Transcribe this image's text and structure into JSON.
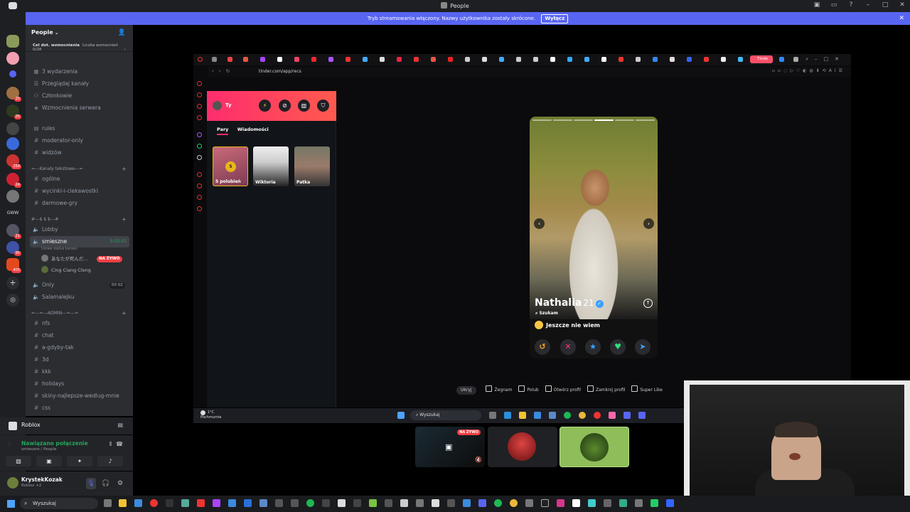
{
  "window": {
    "title": "People"
  },
  "banner": {
    "text": "Tryb streamowania włączony. Nazwy użytkownika zostały skrócone.",
    "button": "Wyłącz"
  },
  "server": {
    "name": "People",
    "boost_goal_label": "Cel dot. wzmocnienia",
    "boost_count": "Liczba wzmocnień 0/28"
  },
  "channels": {
    "events": "3 wydarzenia",
    "browse": "Przeglądaj kanały",
    "members": "Członkowie",
    "boosts": "Wzmocnienia serwera",
    "rules": "rules",
    "moderator_only": "moderator-only",
    "widzow": "widzów",
    "cat_text": "=---Kanały tekstowe---=",
    "ogolne": "ogólne",
    "wycinki": "wycinki-i-ciekawostki",
    "darmowe": "darmowe-gry",
    "cat_voice": "#---$ $ $---#",
    "lobby": "Lobby",
    "smieszne": "smieszne",
    "smieszne_timer": "5:03:01",
    "smieszne_sub": "Ustaw status kanału",
    "voice_user_1": "あなたが死んだ...",
    "live_badge": "NA ŻYWO",
    "voice_user_2": "Cing Ciang Clong",
    "only": "Only",
    "only_count": "00 02",
    "salamalejku": "Salamalejku",
    "cat_admin": "=---=---ADMIN---=---=",
    "nfs": "nfs",
    "chat": "chat",
    "agdyby": "a-gdyby-tak",
    "d3": "3d",
    "kkk": "kkk",
    "holidays": "holidays",
    "skiny": "skiny-najlepsze-wedlug-mnie",
    "css": "css"
  },
  "activity": {
    "game": "Roblox"
  },
  "voice": {
    "status": "Nawiązano połączenie",
    "channel": "smieszne / People"
  },
  "user": {
    "name": "KrystekKozak",
    "status": "Roblox +2"
  },
  "browser": {
    "url": "tinder.com/app/recs",
    "tinder_tab": "Tinde",
    "ai_label": "AI"
  },
  "tinder": {
    "me": "Ty",
    "tab_pairs": "Pary",
    "tab_messages": "Wiadomości",
    "likes_count": "5",
    "likes_label": "5 polubień",
    "match_1": "Wiktoria",
    "match_2": "Patka",
    "profile_name": "Nathalia",
    "profile_age": "21",
    "looking_label": "Szukam",
    "looking_value": "Jeszcze nie wiem"
  },
  "hints": {
    "hide": "Ukryj",
    "nope": "Żegnam",
    "like": "Polub",
    "open": "Otwórz profil",
    "close": "Zamknij profil",
    "superlike": "Super Like"
  },
  "stream_taskbar": {
    "temp": "1°C",
    "weather": "Pochmurnie",
    "search": "Wyszukaj"
  },
  "tiles": {
    "live": "NA ŻYWO"
  },
  "taskbar": {
    "search": "Wyszukaj"
  },
  "colors": {
    "discord_blurple": "#5865f2",
    "tinder_pink": "#fd2d6d",
    "online_green": "#23a55a"
  }
}
